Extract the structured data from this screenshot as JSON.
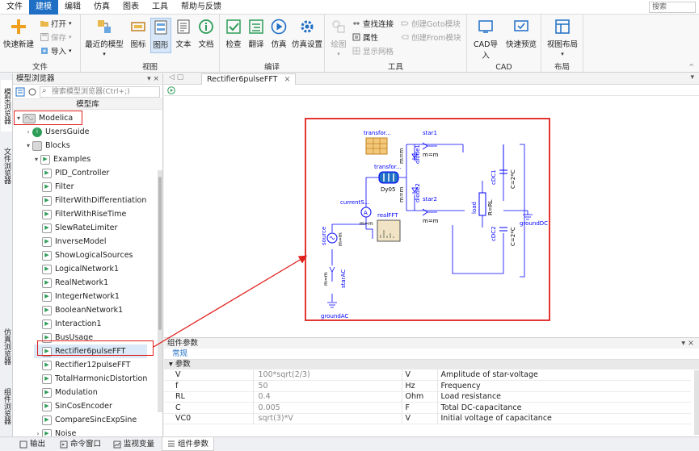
{
  "menu": {
    "items": [
      "文件",
      "建模",
      "编辑",
      "仿真",
      "图表",
      "工具",
      "帮助与反馈"
    ],
    "active_index": 1,
    "search_placeholder": "搜索"
  },
  "ribbon": {
    "file_group": {
      "label": "文件",
      "quick_new": "快速新建",
      "open": "打开",
      "save": "保存",
      "import": "导入"
    },
    "view_group": {
      "label": "视图",
      "recent_models": "最近的模型",
      "icon": "图标",
      "diagram": "图形",
      "text": "文本",
      "doc": "文档"
    },
    "compile_group": {
      "label": "编译",
      "check": "检查",
      "translate": "翻译",
      "simulate": "仿真",
      "sim_settings": "仿真设置"
    },
    "tools_group": {
      "label": "工具",
      "draw": "绘图",
      "find_connection": "查找连接",
      "properties": "属性",
      "show_grid": "显示网格",
      "create_goto": "创建Goto模块",
      "create_from": "创建From模块"
    },
    "cad_group": {
      "label": "CAD",
      "cad_import": "CAD导入",
      "quick_preview": "快速预览"
    },
    "layout_group": {
      "label": "布局",
      "view_layout": "视图布局"
    }
  },
  "side_tabs": [
    "模型浏览器",
    "文件浏览器",
    "仿真浏览器",
    "组件浏览器"
  ],
  "browser": {
    "title": "模型浏览器",
    "search_placeholder": "搜索模型浏览器(Ctrl+;)",
    "library_header": "模型库",
    "tree": [
      {
        "label": "Modelica",
        "level": 0,
        "expanded": true,
        "icon": "modelica-icon"
      },
      {
        "label": "UsersGuide",
        "level": 1,
        "expanded": false,
        "icon": "info-icon"
      },
      {
        "label": "Blocks",
        "level": 1,
        "expanded": true,
        "icon": "package-icon"
      },
      {
        "label": "Examples",
        "level": 2,
        "expanded": true,
        "icon": "example-icon"
      },
      {
        "label": "PID_Controller",
        "level": 3,
        "icon": "model-icon"
      },
      {
        "label": "Filter",
        "level": 3,
        "icon": "model-icon"
      },
      {
        "label": "FilterWithDifferentiation",
        "level": 3,
        "icon": "model-icon"
      },
      {
        "label": "FilterWithRiseTime",
        "level": 3,
        "icon": "model-icon"
      },
      {
        "label": "SlewRateLimiter",
        "level": 3,
        "icon": "model-icon"
      },
      {
        "label": "InverseModel",
        "level": 3,
        "icon": "model-icon"
      },
      {
        "label": "ShowLogicalSources",
        "level": 3,
        "icon": "model-icon"
      },
      {
        "label": "LogicalNetwork1",
        "level": 3,
        "icon": "model-icon"
      },
      {
        "label": "RealNetwork1",
        "level": 3,
        "icon": "model-icon"
      },
      {
        "label": "IntegerNetwork1",
        "level": 3,
        "icon": "model-icon"
      },
      {
        "label": "BooleanNetwork1",
        "level": 3,
        "icon": "model-icon"
      },
      {
        "label": "Interaction1",
        "level": 3,
        "icon": "model-icon"
      },
      {
        "label": "BusUsage",
        "level": 3,
        "icon": "model-icon"
      },
      {
        "label": "Rectifier6pulseFFT",
        "level": 3,
        "icon": "model-icon",
        "selected": true
      },
      {
        "label": "Rectifier12pulseFFT",
        "level": 3,
        "icon": "model-icon"
      },
      {
        "label": "TotalHarmonicDistortion",
        "level": 3,
        "icon": "model-icon"
      },
      {
        "label": "Modulation",
        "level": 3,
        "icon": "model-icon"
      },
      {
        "label": "SinCosEncoder",
        "level": 3,
        "icon": "model-icon"
      },
      {
        "label": "CompareSincExpSine",
        "level": 3,
        "icon": "model-icon"
      },
      {
        "label": "Noise",
        "level": 3,
        "icon": "model-icon",
        "expandable": true
      }
    ]
  },
  "editor": {
    "tab_label": "Rectifier6pulseFFT",
    "diagram": {
      "transformer_top_label": "transfor...",
      "transformer_mid_label": "transfor...",
      "transformer_type": "Dy05",
      "star1": "star1",
      "star2": "star2",
      "diode1": "diode1",
      "diode2": "diode2",
      "mm": "m=m",
      "current_sensor": "currentS...",
      "real_fft": "realFFT",
      "source": "source",
      "star_ac": "starAC",
      "ground_ac": "groundAC",
      "cdc1": "cDC1",
      "cdc2": "cDC2",
      "cap_label": "C=2*C",
      "load": "load",
      "resistor": "R=RL",
      "ground_dc": "groundDC"
    }
  },
  "props": {
    "title": "组件参数",
    "tab": "常规",
    "group": "参数",
    "rows": [
      {
        "name": "V",
        "value": "100*sqrt(2/3)",
        "unit": "V",
        "desc": "Amplitude of star-voltage"
      },
      {
        "name": "f",
        "value": "50",
        "unit": "Hz",
        "desc": "Frequency"
      },
      {
        "name": "RL",
        "value": "0.4",
        "unit": "Ohm",
        "desc": "Load resistance"
      },
      {
        "name": "C",
        "value": "0.005",
        "unit": "F",
        "desc": "Total DC-capacitance"
      },
      {
        "name": "VC0",
        "value": "sqrt(3)*V",
        "unit": "V",
        "desc": "Initial voltage of capacitance"
      }
    ]
  },
  "bottom_tabs": [
    "输出",
    "命令窗口",
    "监视变量",
    "组件参数"
  ],
  "colors": {
    "accent": "#1f6fc5",
    "highlight": "#e0201b",
    "diagram_blue": "#0000ff"
  }
}
